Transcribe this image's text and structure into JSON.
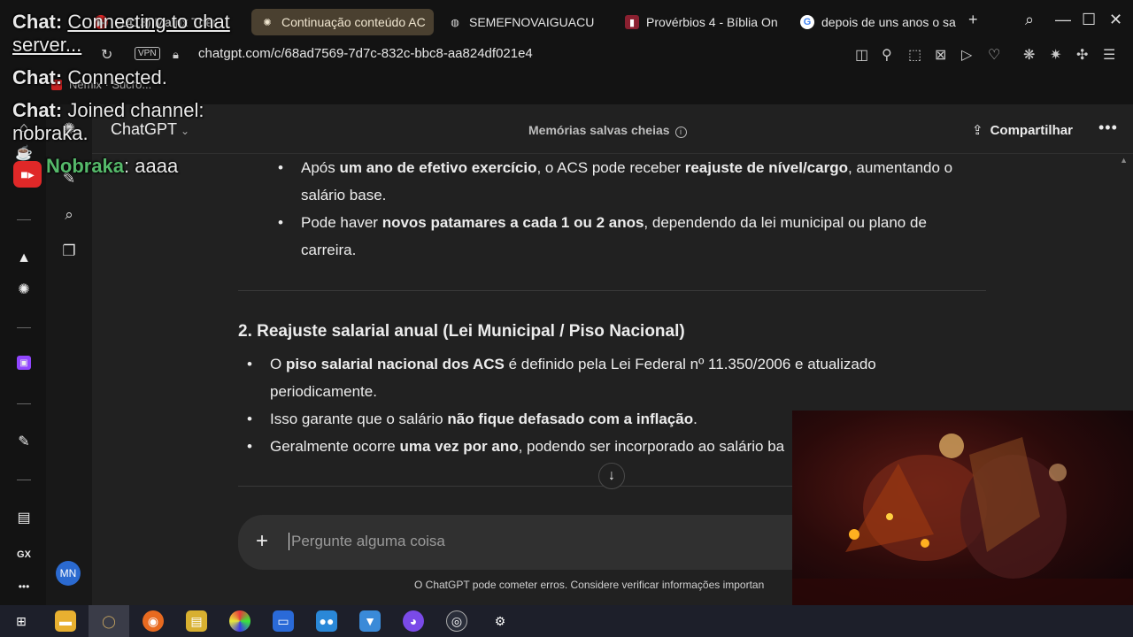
{
  "browser": {
    "tabs": [
      {
        "title": "(1413) Matrix Ther",
        "icon": "youtube-icon"
      },
      {
        "title": "Continuação conteúdo AC",
        "icon": "chatgpt-icon",
        "active": true
      },
      {
        "title": "SEMEFNOVAIGUACU",
        "icon": "globe-icon"
      },
      {
        "title": "Provérbios 4 - Bíblia On",
        "icon": "bible-icon"
      },
      {
        "title": "depois de uns anos o sa",
        "icon": "google-icon"
      }
    ],
    "new_tab": "+",
    "vpn_label": "VPN",
    "url": "chatgpt.com/c/68ad7569-7d7c-832c-bbc8-aa824df021e4",
    "bookmark_partial": "Nemix · Sucro..."
  },
  "chatgpt": {
    "model": "ChatGPT",
    "memory_status": "Memórias salvas cheias",
    "share_label": "Compartilhar",
    "more_label": "•••",
    "avatar_initials": "MN",
    "section1_bullets": [
      {
        "pre": "Após ",
        "b1": "um ano de efetivo exercício",
        "mid": ", o ACS pode receber ",
        "b2": "reajuste de nível/cargo",
        "post": ", aumentando o salário base."
      },
      {
        "pre": "Pode haver ",
        "b1": "novos patamares a cada 1 ou 2 anos",
        "mid": ", dependendo da lei municipal ou plano de carreira.",
        "b2": "",
        "post": ""
      }
    ],
    "section2_title": "2. Reajuste salarial anual (Lei Municipal / Piso Nacional)",
    "section2_bullets": [
      {
        "pre": "O ",
        "b1": "piso salarial nacional dos ACS",
        "mid": " é definido pela Lei Federal nº 11.350/2006 e atualizado periodicamente.",
        "b2": "",
        "post": ""
      },
      {
        "pre": "Isso garante que o salário ",
        "b1": "não fique defasado com a inflação",
        "mid": ".",
        "b2": "",
        "post": ""
      },
      {
        "pre": "Geralmente ocorre ",
        "b1": "uma vez por ano",
        "mid": ", podendo ser incorporado ao salário ba",
        "b2": "",
        "post": ""
      }
    ],
    "composer_placeholder": "Pergunte alguma coisa",
    "disclaimer": "O ChatGPT pode cometer erros. Considere verificar informações importan"
  },
  "chat_overlay": {
    "line1_label": "Chat",
    "line1_text": "Connecting to chat server...",
    "line2_label": "Chat",
    "line2_text": "Connected.",
    "line3_label": "Chat",
    "line3_text": "Joined channel: nobraka.",
    "msg_user": "Nobraka",
    "msg_text": ": aaaa"
  },
  "opera_sidebar": {
    "gx_label": "GX",
    "more": "•••"
  }
}
